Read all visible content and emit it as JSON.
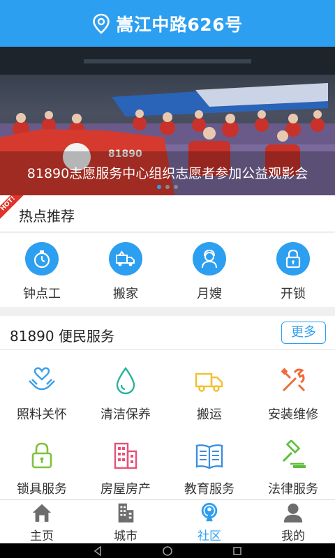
{
  "header": {
    "title": "嵩江中路626号",
    "icon": "location-pin-icon"
  },
  "banner": {
    "caption": "81890志愿服务中心组织志愿者参加公益观影会",
    "slide_count": 3,
    "active_slide": 1,
    "flag_text": "81890"
  },
  "hot": {
    "badge": "HOT!",
    "title": "热点推荐",
    "items": [
      {
        "label": "钟点工",
        "icon": "stopwatch-icon"
      },
      {
        "label": "搬家",
        "icon": "moving-truck-icon"
      },
      {
        "label": "月嫂",
        "icon": "nanny-icon"
      },
      {
        "label": "开锁",
        "icon": "lock-icon"
      }
    ]
  },
  "services": {
    "title": "81890 便民服务",
    "more_label": "更多",
    "items": [
      {
        "label": "照料关怀",
        "icon": "care-hands-icon",
        "color": "#3aa0e8"
      },
      {
        "label": "清洁保养",
        "icon": "water-drop-icon",
        "color": "#27b39a"
      },
      {
        "label": "搬运",
        "icon": "truck-icon",
        "color": "#f2c12e"
      },
      {
        "label": "安装维修",
        "icon": "repair-tools-icon",
        "color": "#f06a3a"
      },
      {
        "label": "锁具服务",
        "icon": "padlock-icon",
        "color": "#7cc23a"
      },
      {
        "label": "房屋房产",
        "icon": "building-icon",
        "color": "#e8507a"
      },
      {
        "label": "教育服务",
        "icon": "book-icon",
        "color": "#3a8fe0"
      },
      {
        "label": "法律服务",
        "icon": "gavel-icon",
        "color": "#5cbf3a"
      }
    ]
  },
  "nav": {
    "items": [
      {
        "label": "主页",
        "icon": "home-icon",
        "active": false
      },
      {
        "label": "城市",
        "icon": "city-icon",
        "active": false
      },
      {
        "label": "社区",
        "icon": "community-icon",
        "active": true
      },
      {
        "label": "我的",
        "icon": "profile-icon",
        "active": false
      }
    ]
  },
  "colors": {
    "primary": "#2d9ff0",
    "hot_red": "#e0332a"
  }
}
